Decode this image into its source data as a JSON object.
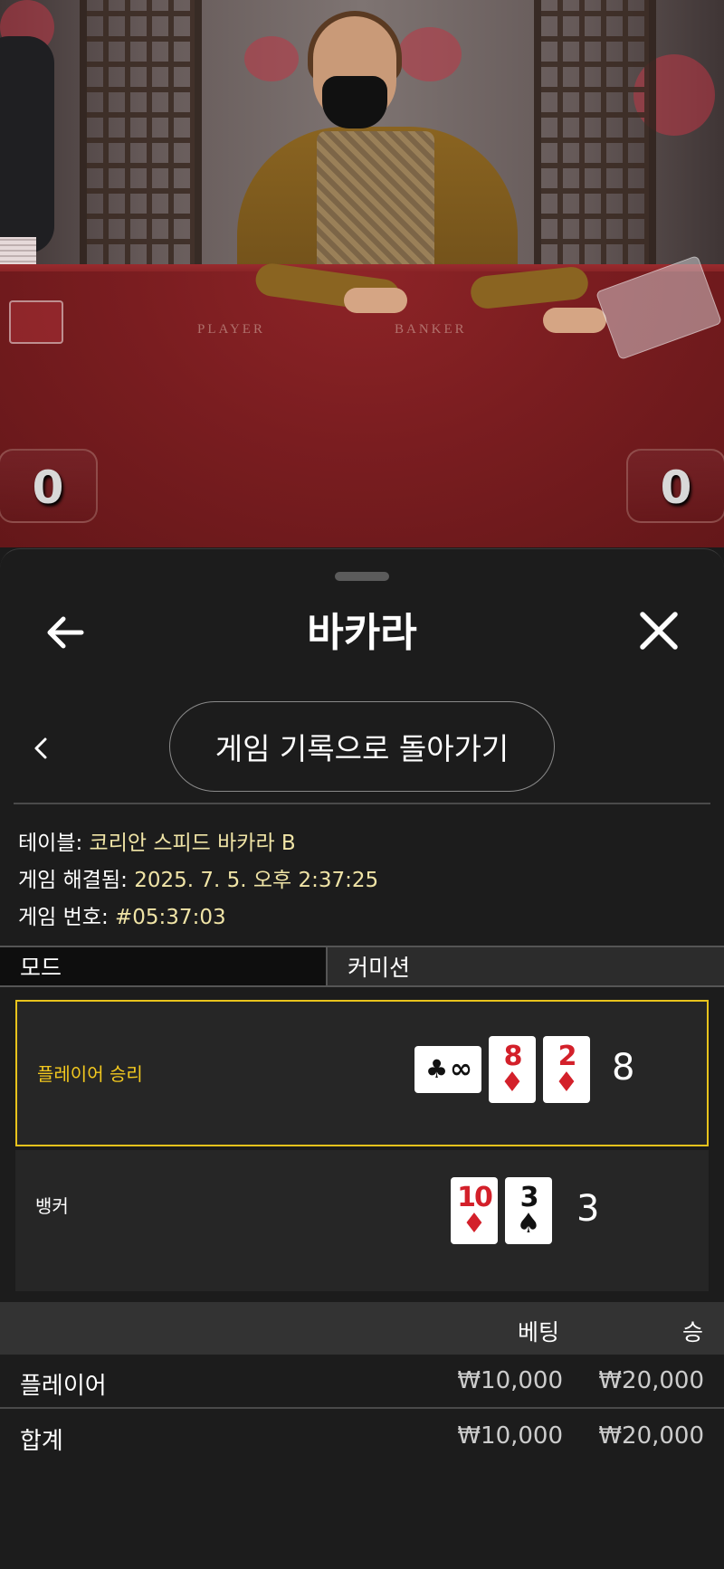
{
  "video": {
    "felt_player": "PLAYER",
    "felt_banker": "BANKER",
    "player_score": "0",
    "banker_score": "0"
  },
  "header": {
    "title": "바카라"
  },
  "history_button": "게임 기록으로 돌아가기",
  "info": {
    "table_label": "테이블:",
    "table_value": "코리안 스피드 바카라 B",
    "resolved_label": "게임 해결됨:",
    "resolved_value": "2025. 7. 5. 오후 2:37:25",
    "game_no_label": "게임 번호:",
    "game_no_value": "#05:37:03"
  },
  "tabs": {
    "mode": "모드",
    "commission": "커미션"
  },
  "hands": {
    "player": {
      "label": "플레이어 승리",
      "score": "8",
      "cards": [
        {
          "rank": "∞",
          "suit": "♣",
          "color": "black",
          "orientation": "sideways"
        },
        {
          "rank": "8",
          "suit": "♦",
          "color": "red"
        },
        {
          "rank": "2",
          "suit": "♦",
          "color": "red"
        }
      ]
    },
    "banker": {
      "label": "뱅커",
      "score": "3",
      "cards": [
        {
          "rank": "10",
          "suit": "♦",
          "color": "red"
        },
        {
          "rank": "3",
          "suit": "♠",
          "color": "black"
        }
      ]
    }
  },
  "bets": {
    "col_bet": "베팅",
    "col_win": "승",
    "rows": [
      {
        "label": "플레이어",
        "bet": "₩10,000",
        "win": "₩20,000"
      },
      {
        "label": "합계",
        "bet": "₩10,000",
        "win": "₩20,000"
      }
    ]
  },
  "colors": {
    "accent_gold": "#e8c31c",
    "info_value": "#f0e4a6",
    "card_red": "#d3202a"
  }
}
